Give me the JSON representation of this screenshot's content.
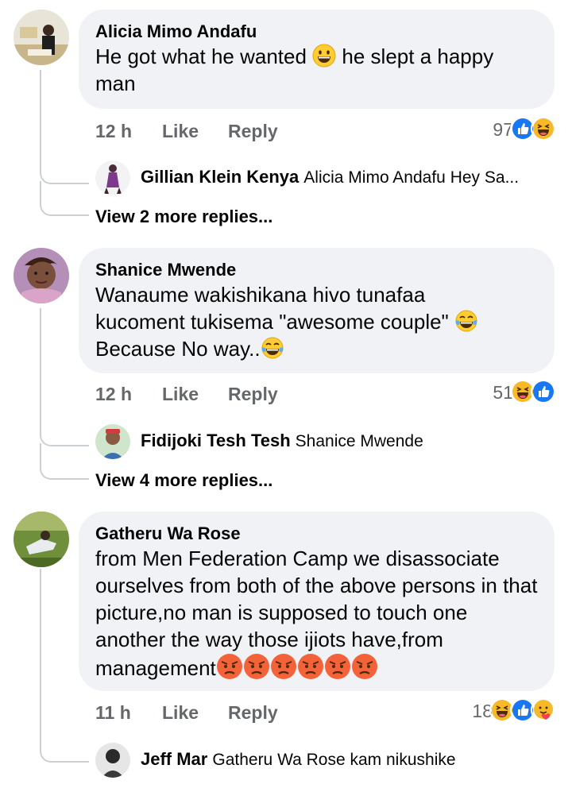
{
  "comments": [
    {
      "author": "Alicia Mimo Andafu",
      "text_before_emoji": "He got what he wanted ",
      "text_after_emoji": " he slept a happy man",
      "time": "12 h",
      "like_label": "Like",
      "reply_label": "Reply",
      "reaction_count": "97",
      "reactions": [
        "like-reaction-icon",
        "haha-reaction-icon"
      ],
      "inline_emoji": "grinning-emoji-icon",
      "reply": {
        "author": "Gillian Klein Kenya",
        "text": "Alicia Mimo Andafu Hey Sa..."
      },
      "more_replies": "View 2 more replies..."
    },
    {
      "author": "Shanice Mwende",
      "line1": "Wanaume wakishikana hivo tunafaa",
      "line2": "kucoment tukisema \"awesome couple\" ",
      "line3": "Because No way..",
      "time": "12 h",
      "like_label": "Like",
      "reply_label": "Reply",
      "reaction_count": "51",
      "reactions": [
        "haha-reaction-icon",
        "like-reaction-icon"
      ],
      "reply": {
        "author": "Fidijoki Tesh Tesh",
        "text": "Shanice Mwende"
      },
      "more_replies": "View 4 more replies..."
    },
    {
      "author": "Gatheru Wa Rose",
      "text": "from Men Federation Camp we disassociate ourselves from both of the above persons in that picture,no man is supposed to touch one another the way those ijiots have,from management",
      "time": "11 h",
      "like_label": "Like",
      "reply_label": "Reply",
      "reaction_count": "18",
      "reactions": [
        "haha-reaction-icon",
        "like-reaction-icon",
        "care-reaction-icon"
      ],
      "trailing_emojis": [
        "angry-emoji-icon",
        "angry-emoji-icon",
        "angry-emoji-icon",
        "angry-emoji-icon",
        "angry-emoji-icon",
        "angry-emoji-icon"
      ],
      "reply": {
        "author": "Jeff Mar",
        "text": "Gatheru Wa Rose kam nikushike"
      }
    }
  ],
  "colors": {
    "bubble": "#f0f2f5",
    "meta_text": "#65676b",
    "like_blue": "#1877f2",
    "haha_yellow": "#f7b928",
    "thread_line": "#ccd0d5"
  }
}
